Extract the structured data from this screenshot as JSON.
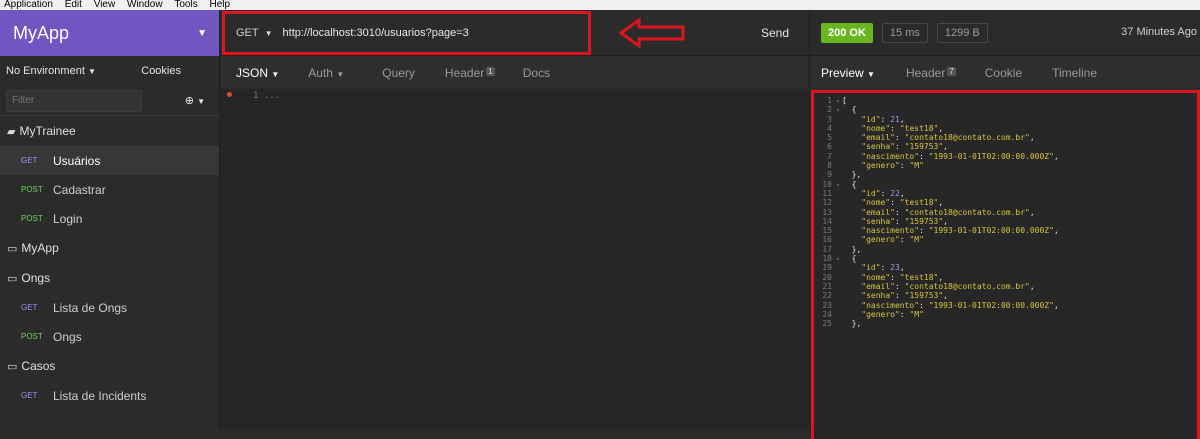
{
  "menubar": [
    "Application",
    "Edit",
    "View",
    "Window",
    "Tools",
    "Help"
  ],
  "sidebar": {
    "app_name": "MyApp",
    "environment": "No Environment",
    "cookies": "Cookies",
    "filter_placeholder": "Filter",
    "items": [
      {
        "type": "folder",
        "label": "MyTrainee"
      },
      {
        "type": "request",
        "method": "GET",
        "label": "Usuários",
        "active": true
      },
      {
        "type": "request",
        "method": "POST",
        "label": "Cadastrar"
      },
      {
        "type": "request",
        "method": "POST",
        "label": "Login"
      },
      {
        "type": "folder",
        "label": "MyApp"
      },
      {
        "type": "folder",
        "label": "Ongs"
      },
      {
        "type": "request",
        "method": "GET",
        "label": "Lista de Ongs"
      },
      {
        "type": "request",
        "method": "POST",
        "label": "Ongs"
      },
      {
        "type": "folder",
        "label": "Casos"
      },
      {
        "type": "request",
        "method": "GET",
        "label": "Lista de Incidents"
      }
    ]
  },
  "request": {
    "method": "GET",
    "url": "http://localhost:3010/usuarios?page=3",
    "send_label": "Send",
    "tabs": {
      "json": "JSON",
      "auth": "Auth",
      "query": "Query",
      "header": "Header",
      "header_count": "1",
      "docs": "Docs"
    },
    "editor_line": "1 ..."
  },
  "response": {
    "status": "200 OK",
    "time": "15 ms",
    "size": "1299 B",
    "ago": "37 Minutes Ago",
    "tabs": {
      "preview": "Preview",
      "header": "Header",
      "header_count": "7",
      "cookie": "Cookie",
      "timeline": "Timeline"
    },
    "json_lines": [
      {
        "n": "1",
        "f": "▾",
        "t": "[",
        "kind": "p"
      },
      {
        "n": "2",
        "f": "▾",
        "t": "  {",
        "kind": "p"
      },
      {
        "n": "3",
        "k": "\"id\"",
        "v": "21",
        "vk": "n"
      },
      {
        "n": "4",
        "k": "\"nome\"",
        "v": "\"test18\"",
        "vk": "s"
      },
      {
        "n": "5",
        "k": "\"email\"",
        "v": "\"contato18@contato.com.br\"",
        "vk": "s"
      },
      {
        "n": "6",
        "k": "\"senha\"",
        "v": "\"159753\"",
        "vk": "s"
      },
      {
        "n": "7",
        "k": "\"nascimento\"",
        "v": "\"1993-01-01T02:00:00.000Z\"",
        "vk": "s"
      },
      {
        "n": "8",
        "k": "\"genero\"",
        "v": "\"M\"",
        "vk": "s",
        "last": true
      },
      {
        "n": "9",
        "t": "  },",
        "kind": "p"
      },
      {
        "n": "10",
        "f": "▾",
        "t": "  {",
        "kind": "p"
      },
      {
        "n": "11",
        "k": "\"id\"",
        "v": "22",
        "vk": "n"
      },
      {
        "n": "12",
        "k": "\"nome\"",
        "v": "\"test18\"",
        "vk": "s"
      },
      {
        "n": "13",
        "k": "\"email\"",
        "v": "\"contato18@contato.com.br\"",
        "vk": "s"
      },
      {
        "n": "14",
        "k": "\"senha\"",
        "v": "\"159753\"",
        "vk": "s"
      },
      {
        "n": "15",
        "k": "\"nascimento\"",
        "v": "\"1993-01-01T02:00:00.000Z\"",
        "vk": "s"
      },
      {
        "n": "16",
        "k": "\"genero\"",
        "v": "\"M\"",
        "vk": "s",
        "last": true
      },
      {
        "n": "17",
        "t": "  },",
        "kind": "p"
      },
      {
        "n": "18",
        "f": "▾",
        "t": "  {",
        "kind": "p"
      },
      {
        "n": "19",
        "k": "\"id\"",
        "v": "23",
        "vk": "n"
      },
      {
        "n": "20",
        "k": "\"nome\"",
        "v": "\"test18\"",
        "vk": "s"
      },
      {
        "n": "21",
        "k": "\"email\"",
        "v": "\"contato18@contato.com.br\"",
        "vk": "s"
      },
      {
        "n": "22",
        "k": "\"senha\"",
        "v": "\"159753\"",
        "vk": "s"
      },
      {
        "n": "23",
        "k": "\"nascimento\"",
        "v": "\"1993-01-01T02:00:00.000Z\"",
        "vk": "s"
      },
      {
        "n": "24",
        "k": "\"genero\"",
        "v": "\"M\"",
        "vk": "s",
        "last": true
      },
      {
        "n": "25",
        "t": "  },",
        "kind": "p"
      }
    ]
  },
  "colors": {
    "accent": "#7156c1",
    "highlight": "#e0141e",
    "ok": "#6ab621",
    "get": "#9f8ff0",
    "post": "#6fd35a"
  }
}
